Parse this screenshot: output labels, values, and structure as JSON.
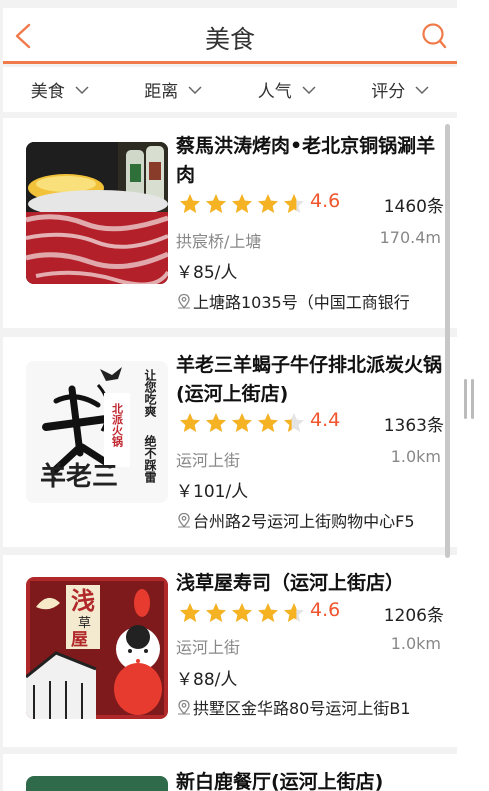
{
  "header": {
    "title": "美食"
  },
  "filters": [
    {
      "label": "美食"
    },
    {
      "label": "距离"
    },
    {
      "label": "人气"
    },
    {
      "label": "评分"
    }
  ],
  "restaurants": [
    {
      "name": "蔡馬洪涛烤肉•老北京铜锅涮羊肉",
      "rating": 4.6,
      "rating_text": "4.6",
      "reviews": "1460条",
      "area": "拱宸桥/上塘",
      "distance": "170.4m",
      "price": "￥85/人",
      "address": "上塘路1035号（中国工商银行"
    },
    {
      "name": "羊老三羊蝎子牛仔排北派炭火锅(运河上街店)",
      "rating": 4.4,
      "rating_text": "4.4",
      "reviews": "1363条",
      "area": "运河上街",
      "distance": "1.0km",
      "price": "￥101/人",
      "address": "台州路2号运河上街购物中心F5",
      "image_text": {
        "brand": "羊老三",
        "seal": "北派火锅",
        "slogan1": "让您吃爽",
        "slogan2": "绝不踩雷"
      }
    },
    {
      "name": "浅草屋寿司（运河上街店）",
      "rating": 4.6,
      "rating_text": "4.6",
      "reviews": "1206条",
      "area": "运河上街",
      "distance": "1.0km",
      "price": "￥88/人",
      "address": "拱墅区金华路80号运河上街B1",
      "image_text": {
        "sign1": "浅",
        "sign2": "草",
        "sign3": "屋"
      }
    },
    {
      "name": "新白鹿餐厅(运河上街店)"
    }
  ],
  "colors": {
    "accent": "#f07a4a",
    "star": "#f5b324",
    "score": "#f0552d"
  },
  "icons": {
    "back": "chevron-left-icon",
    "search": "search-icon",
    "dropdown": "chevron-down-icon",
    "location": "location-pin-icon"
  }
}
